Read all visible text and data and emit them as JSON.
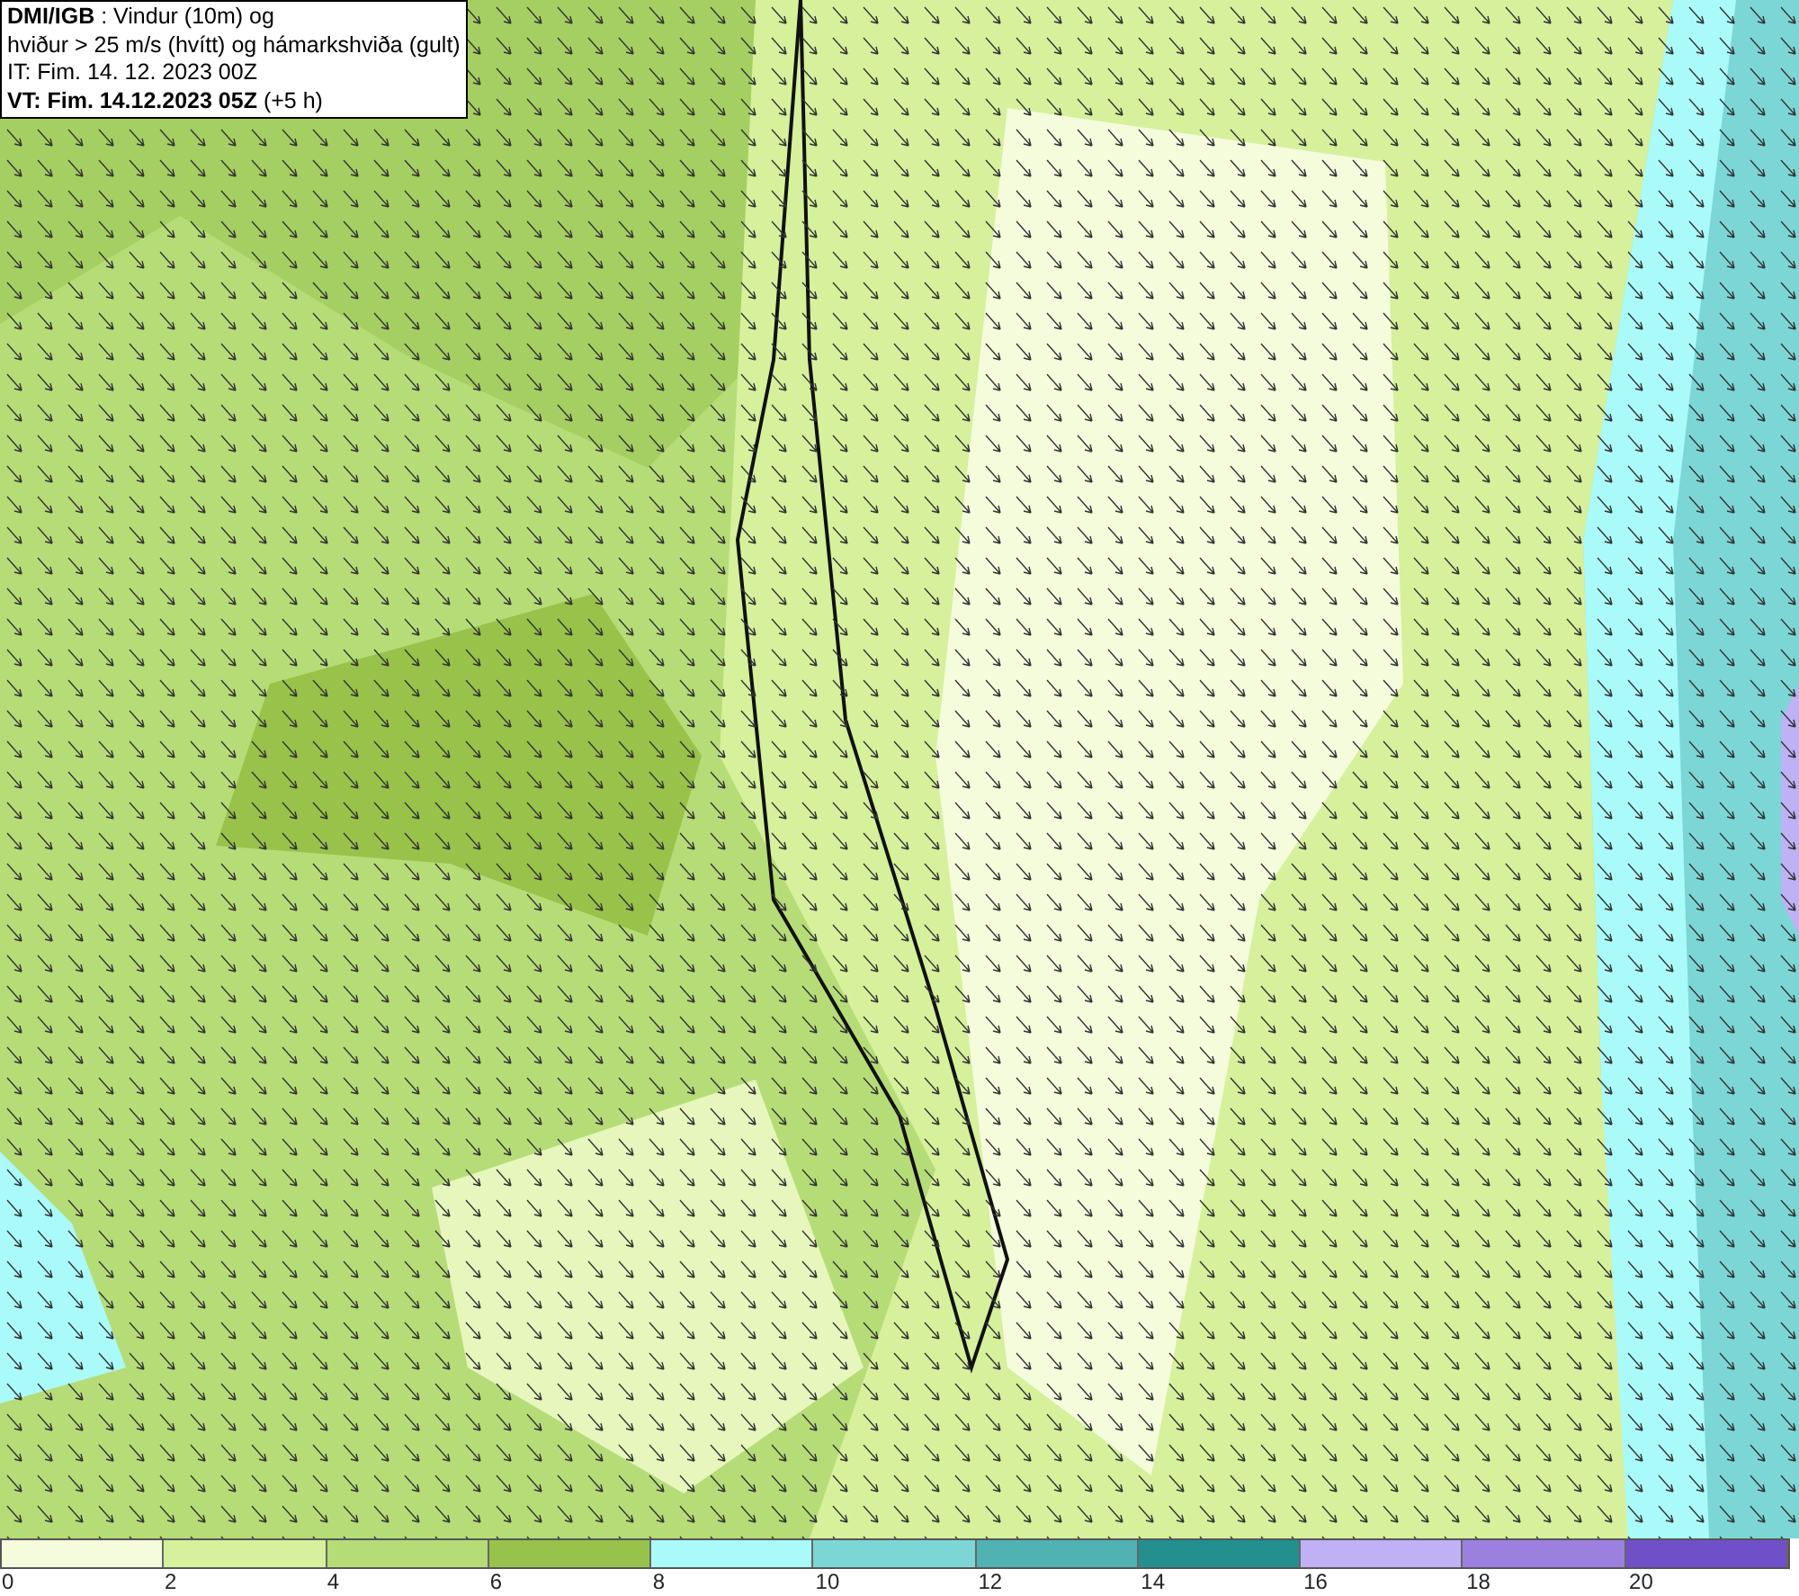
{
  "title_box": {
    "lines": [
      "**DMI/IGB** : Vindur (10m) og",
      "hviður > 25 m/s (hvítt) og hámarkshviða (gult)",
      "IT: Fim. 14. 12. 2023 00Z",
      "**VT: Fim. 14.12.2023 05Z** (+5 h)"
    ]
  },
  "legend": {
    "bins": [
      {
        "color": "#f4fcdc"
      },
      {
        "color": "#d6f09c"
      },
      {
        "color": "#b6dc78"
      },
      {
        "color": "#98c24a"
      },
      {
        "color": "#aafafa"
      },
      {
        "color": "#7dd6d6"
      },
      {
        "color": "#50b2b2"
      },
      {
        "color": "#238f8f"
      },
      {
        "color": "#c0b0f5"
      },
      {
        "color": "#9b80e0"
      },
      {
        "color": "#7050c8"
      }
    ],
    "ticks": [
      "0",
      "2",
      "4",
      "6",
      "8",
      "10",
      "12",
      "14",
      "16",
      "18",
      "20"
    ]
  }
}
